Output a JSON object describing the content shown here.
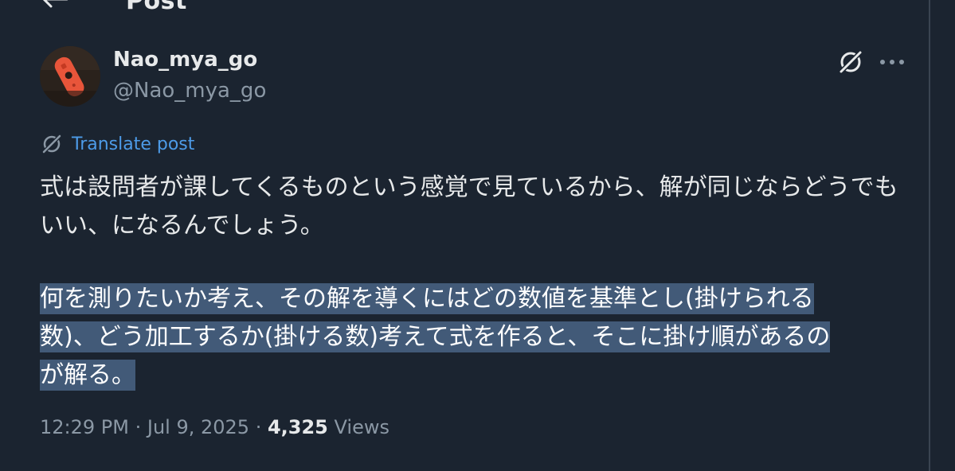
{
  "header": {
    "title": "Post"
  },
  "author": {
    "display_name": "Nao_mya_go",
    "handle": "@Nao_mya_go"
  },
  "actions": {
    "grok_icon": "grok-icon",
    "more_icon": "more-icon"
  },
  "translate": {
    "label": "Translate post"
  },
  "post": {
    "paragraph1": "式は設問者が課してくるものという感覚で見ているから、解が同じならどうでもいい、になるんでしょう。",
    "paragraph2_line1": "何を測りたいか考え、その解を導くにはどの数値を基準とし(掛けられる",
    "paragraph2_line2": "数)、どう加工するか(掛ける数)考えて式を作ると、そこに掛け順があるの",
    "paragraph2_line3": "が解る。"
  },
  "meta": {
    "time": "12:29 PM",
    "separator1": " · ",
    "date": "Jul 9, 2025",
    "separator2": " · ",
    "views_count": "4,325",
    "views_label": " Views"
  },
  "colors": {
    "background": "#1b2430",
    "text_primary": "#e7e9ea",
    "text_secondary": "#8b98a5",
    "link": "#4d9be8",
    "selection": "#425a78"
  }
}
